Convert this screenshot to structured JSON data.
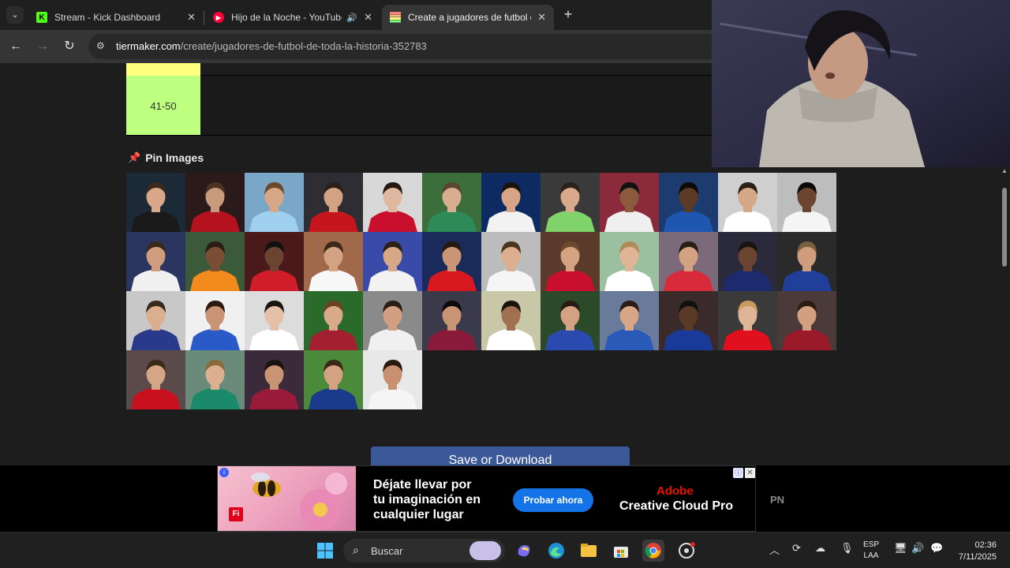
{
  "tabs": [
    {
      "title": "Stream - Kick Dashboard",
      "favicon": "kick-icon",
      "active": false
    },
    {
      "title": "Hijo de la Noche - YouTube",
      "favicon": "youtube-music-icon",
      "active": false,
      "audio": true
    },
    {
      "title": "Create a jugadores de futbol de",
      "favicon": "tiermaker-icon",
      "active": true
    }
  ],
  "toolbar": {
    "url_domain": "tiermaker.com",
    "url_path": "/create/jugadores-de-futbol-de-toda-la-historia-352783"
  },
  "tier": {
    "label": "41-50",
    "color": "#bfff7f",
    "prev_color": "#ffff7f"
  },
  "pin": {
    "title": "Pin Images"
  },
  "save": {
    "label": "Save or Download"
  },
  "ad": {
    "line1": "Déjate llevar por",
    "line2": "tu imaginación en",
    "line3": "cualquier lugar",
    "cta": "Probar ahora",
    "brand_top": "Adobe",
    "brand": "Creative Cloud Pro",
    "fi_badge": "Fi"
  },
  "side_label": "PN",
  "taskbar": {
    "search_label": "Buscar",
    "lang_top": "ESP",
    "lang_bottom": "LAA",
    "time": "02:36",
    "date": "7/11/2025"
  },
  "player_images": [
    {
      "bg": "#1b2a36",
      "shirt": "#1a1a1a",
      "skin": "#d9a88a",
      "hair": "#3a2a1c"
    },
    {
      "bg": "#2a1a1a",
      "shirt": "#b3121e",
      "skin": "#c99b7d",
      "hair": "#4a3322"
    },
    {
      "bg": "#7aa6c8",
      "shirt": "#9fd0f0",
      "skin": "#d6a888",
      "hair": "#6b4a2a"
    },
    {
      "bg": "#2d2d33",
      "shirt": "#c5161d",
      "skin": "#d2a383",
      "hair": "#2a2018"
    },
    {
      "bg": "#d8d8d8",
      "shirt": "#c8102e",
      "skin": "#e0b8a0",
      "hair": "#241a12"
    },
    {
      "bg": "#3b6e3b",
      "shirt": "#2e8b57",
      "skin": "#d9ad8f",
      "hair": "#5a4632"
    },
    {
      "bg": "#0e2a63",
      "shirt": "#f2f2f2",
      "skin": "#d7a585",
      "hair": "#1a140e"
    },
    {
      "bg": "#3a3a3a",
      "shirt": "#7fd36a",
      "skin": "#d9a98b",
      "hair": "#2b221a"
    },
    {
      "bg": "#8a2a3a",
      "shirt": "#efefef",
      "skin": "#8c5a3c",
      "hair": "#111111"
    },
    {
      "bg": "#1c3b6e",
      "shirt": "#1e56b0",
      "skin": "#5b3a26",
      "hair": "#0e0a08"
    },
    {
      "bg": "#cfcfcf",
      "shirt": "#ffffff",
      "skin": "#d4a886",
      "hair": "#2b2016"
    },
    {
      "bg": "#bdbdbd",
      "shirt": "#f5f5f5",
      "skin": "#6b4530",
      "hair": "#0d0a08"
    },
    {
      "bg": "#2a3560",
      "shirt": "#f0f0f0",
      "skin": "#cf9e7e",
      "hair": "#3a2a1c"
    },
    {
      "bg": "#3a5a3a",
      "shirt": "#f28a1c",
      "skin": "#7a4e34",
      "hair": "#2a1c12"
    },
    {
      "bg": "#4a1a1a",
      "shirt": "#d11d2a",
      "skin": "#6a4430",
      "hair": "#111111"
    },
    {
      "bg": "#a06a4a",
      "shirt": "#f7f7f7",
      "skin": "#d3a283",
      "hair": "#3a2818"
    },
    {
      "bg": "#3a4aa8",
      "shirt": "#f2f2f2",
      "skin": "#d6a888",
      "hair": "#2a2016"
    },
    {
      "bg": "#1a2a5a",
      "shirt": "#d7191f",
      "skin": "#c99575",
      "hair": "#241810"
    },
    {
      "bg": "#bcbcbc",
      "shirt": "#f5f5f5",
      "skin": "#dcae90",
      "hair": "#4a3420"
    },
    {
      "bg": "#5a3a2a",
      "shirt": "#c8102e",
      "skin": "#d4a482",
      "hair": "#6a4a2a"
    },
    {
      "bg": "#9ac0a0",
      "shirt": "#ffffff",
      "skin": "#dfb497",
      "hair": "#b08a5a"
    },
    {
      "bg": "#7a6a7a",
      "shirt": "#d82a3a",
      "skin": "#d2a283",
      "hair": "#2a1e14"
    },
    {
      "bg": "#2a2a3a",
      "shirt": "#1e2a6e",
      "skin": "#6a4430",
      "hair": "#1a1410"
    },
    {
      "bg": "#2a2a2a",
      "shirt": "#1f3f9a",
      "skin": "#cf9d7d",
      "hair": "#7a6040"
    },
    {
      "bg": "#c8c8c8",
      "shirt": "#2a3a8a",
      "skin": "#dcae90",
      "hair": "#3a2a1c"
    },
    {
      "bg": "#f0f0f0",
      "shirt": "#2a5ac8",
      "skin": "#c89474",
      "hair": "#2a1a10"
    },
    {
      "bg": "#dcdcdc",
      "shirt": "#ffffff",
      "skin": "#e4c0a8",
      "hair": "#1a140e"
    },
    {
      "bg": "#2a6a2a",
      "shirt": "#a32030",
      "skin": "#d8aa8a",
      "hair": "#6a4420"
    },
    {
      "bg": "#8a8a8a",
      "shirt": "#f0f0f0",
      "skin": "#d2a080",
      "hair": "#2a1e14"
    },
    {
      "bg": "#3a3a4a",
      "shirt": "#8a1a3a",
      "skin": "#c89474",
      "hair": "#0e0a08"
    },
    {
      "bg": "#c8c8a8",
      "shirt": "#ffffff",
      "skin": "#a07050",
      "hair": "#1a140e"
    },
    {
      "bg": "#2a4a2a",
      "shirt": "#2a4ab0",
      "skin": "#d4a282",
      "hair": "#2a1c12"
    },
    {
      "bg": "#6a7a9a",
      "shirt": "#2a5ab8",
      "skin": "#d6a686",
      "hair": "#2a1e14"
    },
    {
      "bg": "#3a2a2a",
      "shirt": "#1a3a9a",
      "skin": "#5a3a26",
      "hair": "#111111"
    },
    {
      "bg": "#3a3a3a",
      "shirt": "#e0101e",
      "skin": "#e0b496",
      "hair": "#c89a60"
    },
    {
      "bg": "#4a3a3a",
      "shirt": "#9a1a2a",
      "skin": "#d2a080",
      "hair": "#2a1c12"
    },
    {
      "bg": "#5a4a4a",
      "shirt": "#c8101e",
      "skin": "#d4a686",
      "hair": "#3a2a1a"
    },
    {
      "bg": "#6a8a7a",
      "shirt": "#1a8a6a",
      "skin": "#dbb090",
      "hair": "#8a6a3a"
    },
    {
      "bg": "#3a2a3a",
      "shirt": "#9a1a3a",
      "skin": "#c89474",
      "hair": "#1a140e"
    },
    {
      "bg": "#4a8a3a",
      "shirt": "#1a3a8a",
      "skin": "#d4a282",
      "hair": "#3a2818"
    },
    {
      "bg": "#e8e8e8",
      "shirt": "#f5f5f5",
      "skin": "#c89070",
      "hair": "#2a1a10"
    }
  ]
}
